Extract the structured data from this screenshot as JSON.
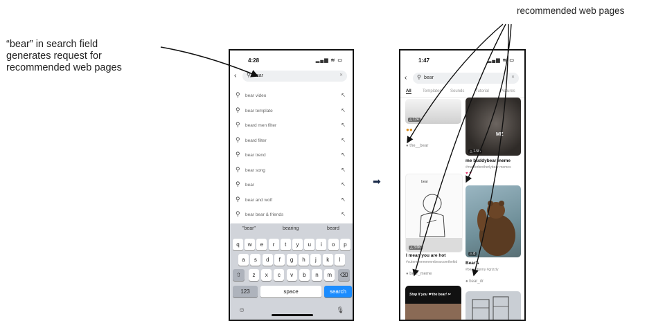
{
  "captions": {
    "left": "“bear” in search field\ngenerates request for\nrecommended web pages",
    "top": "recommended web pages"
  },
  "phone1": {
    "time": "4:28",
    "status_icons": "▂▄▆ ≋ ▭",
    "back_icon": "chevron-left-icon",
    "query": "bear",
    "suggestions": [
      "bear video",
      "bear template",
      "beard men filter",
      "beard filter",
      "bear trend",
      "bear song",
      "bear",
      "bear and wolf",
      "bear bear & friends"
    ],
    "predictions": [
      "\"bear\"",
      "bearing",
      "beard"
    ],
    "rows": [
      [
        "q",
        "w",
        "e",
        "r",
        "t",
        "y",
        "u",
        "i",
        "o",
        "p"
      ],
      [
        "a",
        "s",
        "d",
        "f",
        "g",
        "h",
        "j",
        "k",
        "l"
      ],
      [
        "z",
        "x",
        "c",
        "v",
        "b",
        "n",
        "m"
      ]
    ],
    "shift": "⇧",
    "backspace": "⌫",
    "num_key": "123",
    "space_key": "space",
    "search_key": "search",
    "globe": "☺",
    "mic": "🎙"
  },
  "phone2": {
    "time": "1:47",
    "status_icons": "▂▄▆ ≋ ▭",
    "query": "bear",
    "tabs": [
      "All",
      "Templates",
      "Sounds",
      "Tutorial",
      "Pictures"
    ],
    "cards": {
      "c1": {
        "badge": "△ 124",
        "user": "the__bear"
      },
      "c2": {
        "badge": "△ 1.5M",
        "title": "me buddybear meme",
        "desc": "#meaforbrotherlybear memes",
        "overlay": "ME"
      },
      "c3": {
        "badge": "△ 3.6K",
        "title": "I mean you are hot",
        "desc": "#cutemmmmmmmbearcomthekid",
        "user": "bear_meme",
        "top": "bear"
      },
      "c4": {
        "badge": "△ 8",
        "title": "Bear's",
        "desc": "#bear #funny #grizzly",
        "user": "bear_dr"
      },
      "c5": {
        "overlay": "Stop if you ❤ the bear! ✂"
      }
    },
    "colors": {
      "heart": "#e0336a",
      "accent": "#1a8cff"
    }
  },
  "transition_arrow": "➡"
}
